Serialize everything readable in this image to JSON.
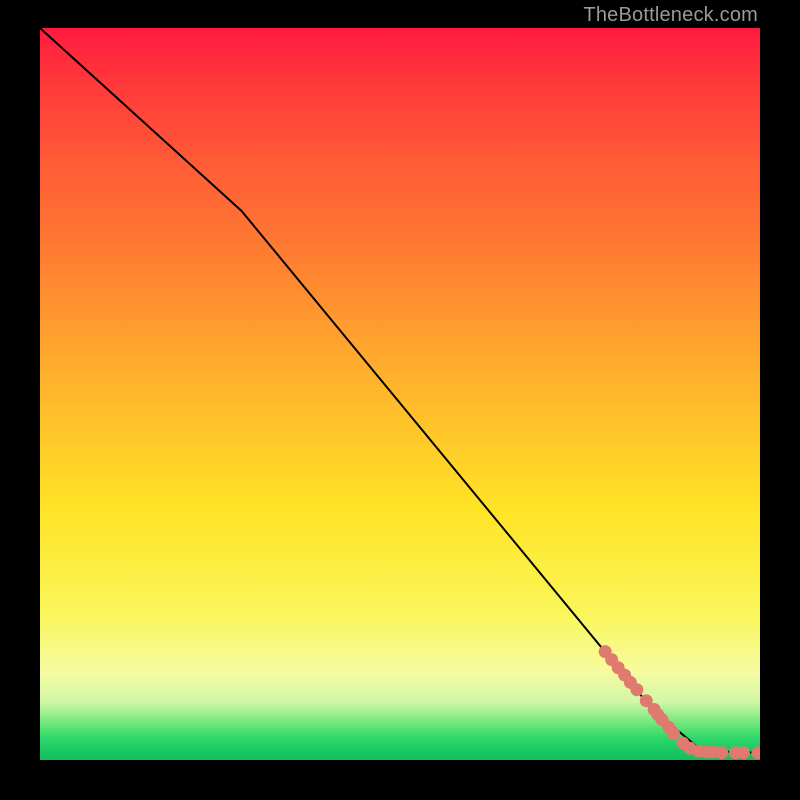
{
  "watermark": "TheBottleneck.com",
  "chart_data": {
    "type": "line",
    "title": "",
    "xlabel": "",
    "ylabel": "",
    "xlim": [
      0,
      100
    ],
    "ylim": [
      0,
      100
    ],
    "background_gradient_meaning": "bottleneck severity (red = high, green = low)",
    "line": {
      "name": "curve",
      "points": [
        {
          "x": 0,
          "y": 100
        },
        {
          "x": 28,
          "y": 75
        },
        {
          "x": 85,
          "y": 7
        },
        {
          "x": 92,
          "y": 1.2
        },
        {
          "x": 100,
          "y": 1.0
        }
      ],
      "stroke": "#000000"
    },
    "scatter": {
      "name": "data-points",
      "color": "#e07a6f",
      "radius_rel": 0.9,
      "points": [
        {
          "x": 78.5,
          "y": 14.8
        },
        {
          "x": 79.4,
          "y": 13.7
        },
        {
          "x": 80.3,
          "y": 12.6
        },
        {
          "x": 81.2,
          "y": 11.6
        },
        {
          "x": 82.0,
          "y": 10.6
        },
        {
          "x": 82.9,
          "y": 9.6
        },
        {
          "x": 84.2,
          "y": 8.1
        },
        {
          "x": 85.3,
          "y": 6.9
        },
        {
          "x": 85.8,
          "y": 6.2
        },
        {
          "x": 86.4,
          "y": 5.5
        },
        {
          "x": 87.3,
          "y": 4.5
        },
        {
          "x": 88.0,
          "y": 3.6
        },
        {
          "x": 89.3,
          "y": 2.3
        },
        {
          "x": 90.3,
          "y": 1.6
        },
        {
          "x": 91.5,
          "y": 1.2
        },
        {
          "x": 92.6,
          "y": 1.1
        },
        {
          "x": 93.6,
          "y": 1.1
        },
        {
          "x": 94.7,
          "y": 1.0
        },
        {
          "x": 96.6,
          "y": 1.0
        },
        {
          "x": 97.7,
          "y": 1.0
        },
        {
          "x": 99.7,
          "y": 1.0
        }
      ]
    }
  }
}
